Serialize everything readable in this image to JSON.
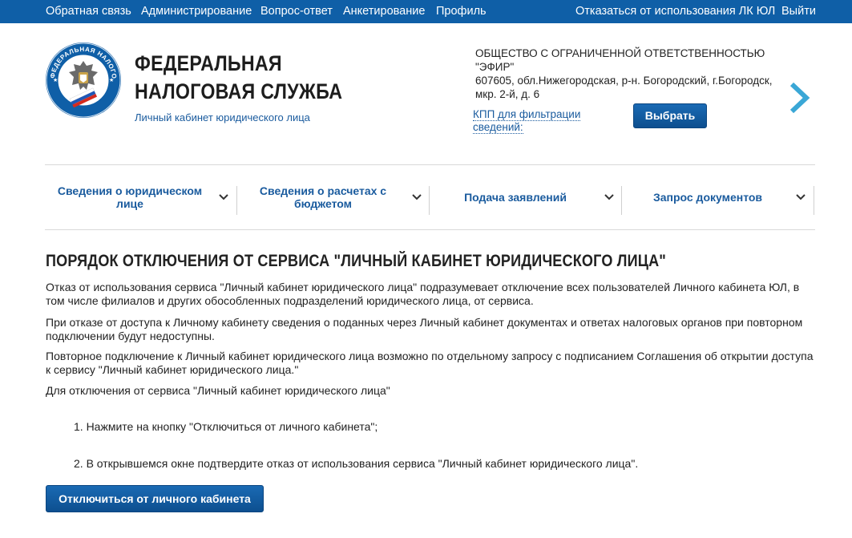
{
  "topbar": {
    "links": [
      "Обратная связь",
      "Администрирование",
      "Вопрос-ответ",
      "Анкетирование",
      "Профиль"
    ],
    "right_links": [
      "Отказаться от использования ЛК ЮЛ",
      "Выйти"
    ]
  },
  "header": {
    "title_line1": "ФЕДЕРАЛЬНАЯ",
    "title_line2": "НАЛОГОВАЯ СЛУЖБА",
    "subtitle": "Личный кабинет юридического лица",
    "logo_ring_text": "ФЕДЕРАЛЬНАЯ НАЛОГОВАЯ СЛУЖБА"
  },
  "org": {
    "name": "ОБЩЕСТВО С ОГРАНИЧЕННОЙ ОТВЕТСТВЕННОСТЬЮ \"ЭФИР\"",
    "address": "607605, обл.Нижегородская, р-н. Богородский, г.Богородск, мкр. 2-й, д. 6",
    "kpp_link": "КПП для фильтрации сведений:",
    "select_button": "Выбрать"
  },
  "nav": {
    "items": [
      "Сведения о юридическом лице",
      "Сведения о расчетах с бюджетом",
      "Подача заявлений",
      "Запрос документов"
    ]
  },
  "content": {
    "heading": "ПОРЯДОК ОТКЛЮЧЕНИЯ ОТ СЕРВИСА \"ЛИЧНЫЙ КАБИНЕТ ЮРИДИЧЕСКОГО ЛИЦА\"",
    "p1": "Отказ от использования сервиса \"Личный кабинет юридического лица\" подразумевает отключение всех пользователей Личного кабинета ЮЛ, в том числе филиалов и других обособленных подразделений юридического лица, от сервиса.",
    "p2": "При отказе от доступа к Личному кабинету сведения о поданных через Личный кабинет документах и ответах налоговых органов при повторном подключении будут недоступны.",
    "p3": "Повторное подключение к Личный кабинет юридического лица возможно по отдельному запросу с подписанием Соглашения об открытии доступа к сервису \"Личный кабинет юридического лица.\"",
    "p4": "Для отключения от сервиса \"Личный кабинет юридического лица\"",
    "steps": [
      "1.  Нажмите на кнопку \"Отключиться от личного кабинета\";",
      "2.  В открывшемся окне подтвердите отказ от использования сервиса \"Личный кабинет юридического лица\"."
    ],
    "disconnect_button": "Отключиться от личного кабинета"
  },
  "colors": {
    "topbar": "#0f5fa7",
    "link": "#1a5b9e",
    "button": "#0d4f8f",
    "arrow": "#3aa7d6"
  },
  "icons": [
    "emblem-logo",
    "chevron-right-icon",
    "chevron-down-icon"
  ]
}
